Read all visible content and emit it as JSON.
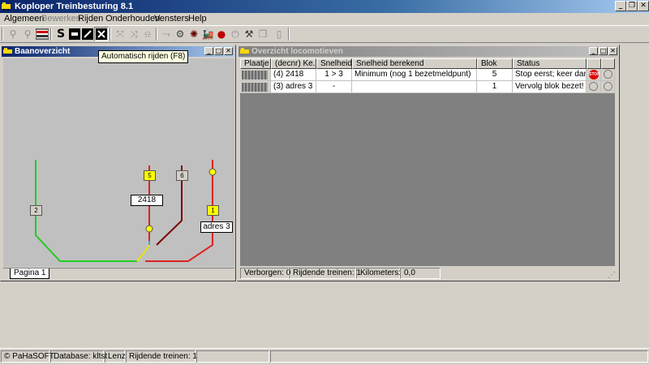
{
  "app": {
    "title": "Koploper Treinbesturing 8.1"
  },
  "menu": {
    "algemeen": "Algemeen",
    "bewerken": "Bewerken",
    "rijden": "Rijden",
    "onderhouden": "Onderhouden",
    "vensters": "Vensters",
    "help": "Help"
  },
  "toolbar": {
    "s_label": "S"
  },
  "tooltip": {
    "text": "Automatisch rijden (F8)"
  },
  "baanoverzicht": {
    "title": "Baanoverzicht",
    "block_labels": [
      "2",
      "5",
      "6",
      "1"
    ],
    "loco_labels": [
      "2418",
      "adres 3"
    ],
    "tab": "Pagina 1"
  },
  "overzicht": {
    "title": "Overzicht locomotieven",
    "columns": [
      "Plaatje",
      "(decnr) Ke...",
      "Snelheid",
      "Snelheid berekend",
      "Blok",
      "Status"
    ],
    "rows": [
      {
        "name": "(4) 2418",
        "speed": "1 > 3",
        "computed": "Minimum  (nog 1 bezetmeldpunt)",
        "block": "5",
        "status": "Stop eerst; keer dan!",
        "stop": "STOP"
      },
      {
        "name": "(3) adres 3",
        "speed": "-",
        "computed": "",
        "block": "1",
        "status": "Vervolg blok bezet!"
      }
    ],
    "footer": {
      "hidden": "Verborgen: 0",
      "driving": "Rijdende treinen: 1",
      "km_label": "Kilometers:",
      "km_value": "0,0"
    }
  },
  "status": {
    "copyright": "© PaHaSOFT",
    "database": "Database: kltst",
    "system": "Lenz",
    "driving": "Rijdende treinen: 1"
  },
  "colors": {
    "title_active": "#0a246a",
    "track_green": "#22cc22",
    "track_red": "#dd2222",
    "track_darkred": "#7a0000",
    "block_yellow": "#ffff00"
  }
}
